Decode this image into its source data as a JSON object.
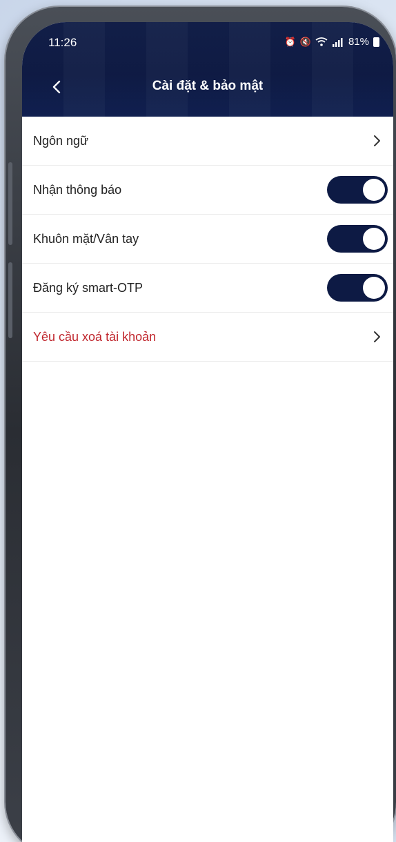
{
  "status_bar": {
    "time": "11:26",
    "battery": "81%"
  },
  "header": {
    "title": "Cài đặt & bảo mật",
    "back_icon": "chevron-left-icon"
  },
  "settings": {
    "items": [
      {
        "label": "Ngôn ngữ",
        "control": "chevron",
        "danger": false
      },
      {
        "label": "Nhận thông báo",
        "control": "toggle",
        "on": true,
        "danger": false
      },
      {
        "label": "Khuôn mặt/Vân tay",
        "control": "toggle",
        "on": true,
        "danger": false
      },
      {
        "label": "Đăng ký smart-OTP",
        "control": "toggle",
        "on": true,
        "danger": false
      },
      {
        "label": "Yêu cầu xoá tài khoản",
        "control": "chevron",
        "danger": true
      }
    ]
  },
  "colors": {
    "header_bg": "#0d1a44",
    "toggle_on": "#0d1a44",
    "danger_text": "#c0262d",
    "text": "#222222"
  }
}
